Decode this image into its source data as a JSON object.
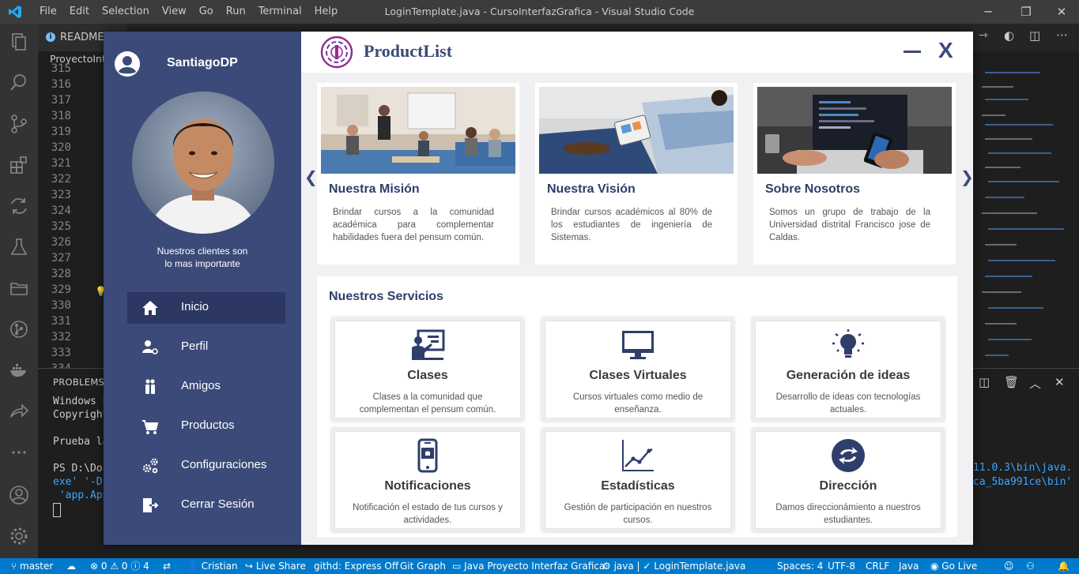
{
  "vscode": {
    "menu": [
      "File",
      "Edit",
      "Selection",
      "View",
      "Go",
      "Run",
      "Terminal",
      "Help"
    ],
    "window_title": "LoginTemplate.java - CursoInterfazGrafica - Visual Studio Code",
    "tab_readme": "README",
    "breadcrumb": "ProyectoInte",
    "line_numbers": [
      "315",
      "316",
      "317",
      "318",
      "319",
      "320",
      "321",
      "322",
      "323",
      "324",
      "325",
      "326",
      "327",
      "328",
      "329",
      "330",
      "331",
      "332",
      "333",
      "334"
    ],
    "panel_title": "PROBLEMS",
    "terminal_lines": [
      "Windows P",
      "Copyright",
      "",
      "Prueba la",
      "",
      "PS D:\\Doc",
      "exe' '-Df",
      " 'app.App"
    ],
    "terminal_right_1": "11.0.3\\bin\\java.",
    "terminal_right_2": "ca_5ba991ce\\bin'",
    "status": {
      "branch": "master",
      "problems": "⊗ 0 ⚠ 0 ⓘ 4",
      "user": "Cristian",
      "live_share": "Live Share",
      "githd": "githd: Express Off",
      "git_graph": "Git Graph",
      "project": "Java Proyecto Interfaz Grafica",
      "java": "java | ✓ LoginTemplate.java",
      "spaces": "Spaces: 4",
      "encoding": "UTF-8",
      "eol": "CRLF",
      "language": "Java",
      "go_live": "Go Live"
    }
  },
  "app": {
    "user_name": "SantiagoDP",
    "tagline_1": "Nuestros clientes son",
    "tagline_2": "lo mas importante",
    "nav": [
      {
        "label": "Inicio",
        "icon": "home-icon",
        "active": true
      },
      {
        "label": "Perfil",
        "icon": "profile-icon",
        "active": false
      },
      {
        "label": "Amigos",
        "icon": "friends-icon",
        "active": false
      },
      {
        "label": "Productos",
        "icon": "cart-icon",
        "active": false
      },
      {
        "label": "Configuraciones",
        "icon": "gears-icon",
        "active": false
      },
      {
        "label": "Cerrar Sesión",
        "icon": "logout-icon",
        "active": false
      }
    ],
    "brand": "ProductList",
    "close_label": "X",
    "carousel_prev": "❮",
    "carousel_next": "❯",
    "cards": [
      {
        "title": "Nuestra Misión",
        "desc": "Brindar cursos a la comunidad académica para complementar habilidades fuera del pensum común."
      },
      {
        "title": "Nuestra Visión",
        "desc": "Brindar cursos académicos al 80% de los estudiantes de ingeniería de Sistemas."
      },
      {
        "title": "Sobre Nosotros",
        "desc": "Somos un grupo de trabajo de la Universidad distrital Francisco jose de Caldas."
      }
    ],
    "services_title": "Nuestros Servicios",
    "services": [
      {
        "name": "Clases",
        "desc": "Clases a la comunidad que complementan el pensum común.",
        "icon": "teacher-board-icon"
      },
      {
        "name": "Clases Virtuales",
        "desc": "Cursos virtuales como medio de enseñanza.",
        "icon": "monitor-icon"
      },
      {
        "name": "Generación de ideas",
        "desc": "Desarrollo de ideas con tecnologías actuales.",
        "icon": "lightbulb-icon"
      },
      {
        "name": "Notificaciones",
        "desc": "Notificación el estado de tus cursos y actividades.",
        "icon": "phone-notification-icon"
      },
      {
        "name": "Estadísticas",
        "desc": "Gestión de participación en nuestros cursos.",
        "icon": "line-chart-icon"
      },
      {
        "name": "Dirección",
        "desc": "Damos direccionámiento a nuestros estudiantes.",
        "icon": "direction-arrows-icon"
      }
    ],
    "colors": {
      "sidebar": "#3b4a78",
      "sidebar_active": "#2c3763",
      "accent": "#2f3e6b",
      "logo": "#8e2d8e"
    }
  }
}
